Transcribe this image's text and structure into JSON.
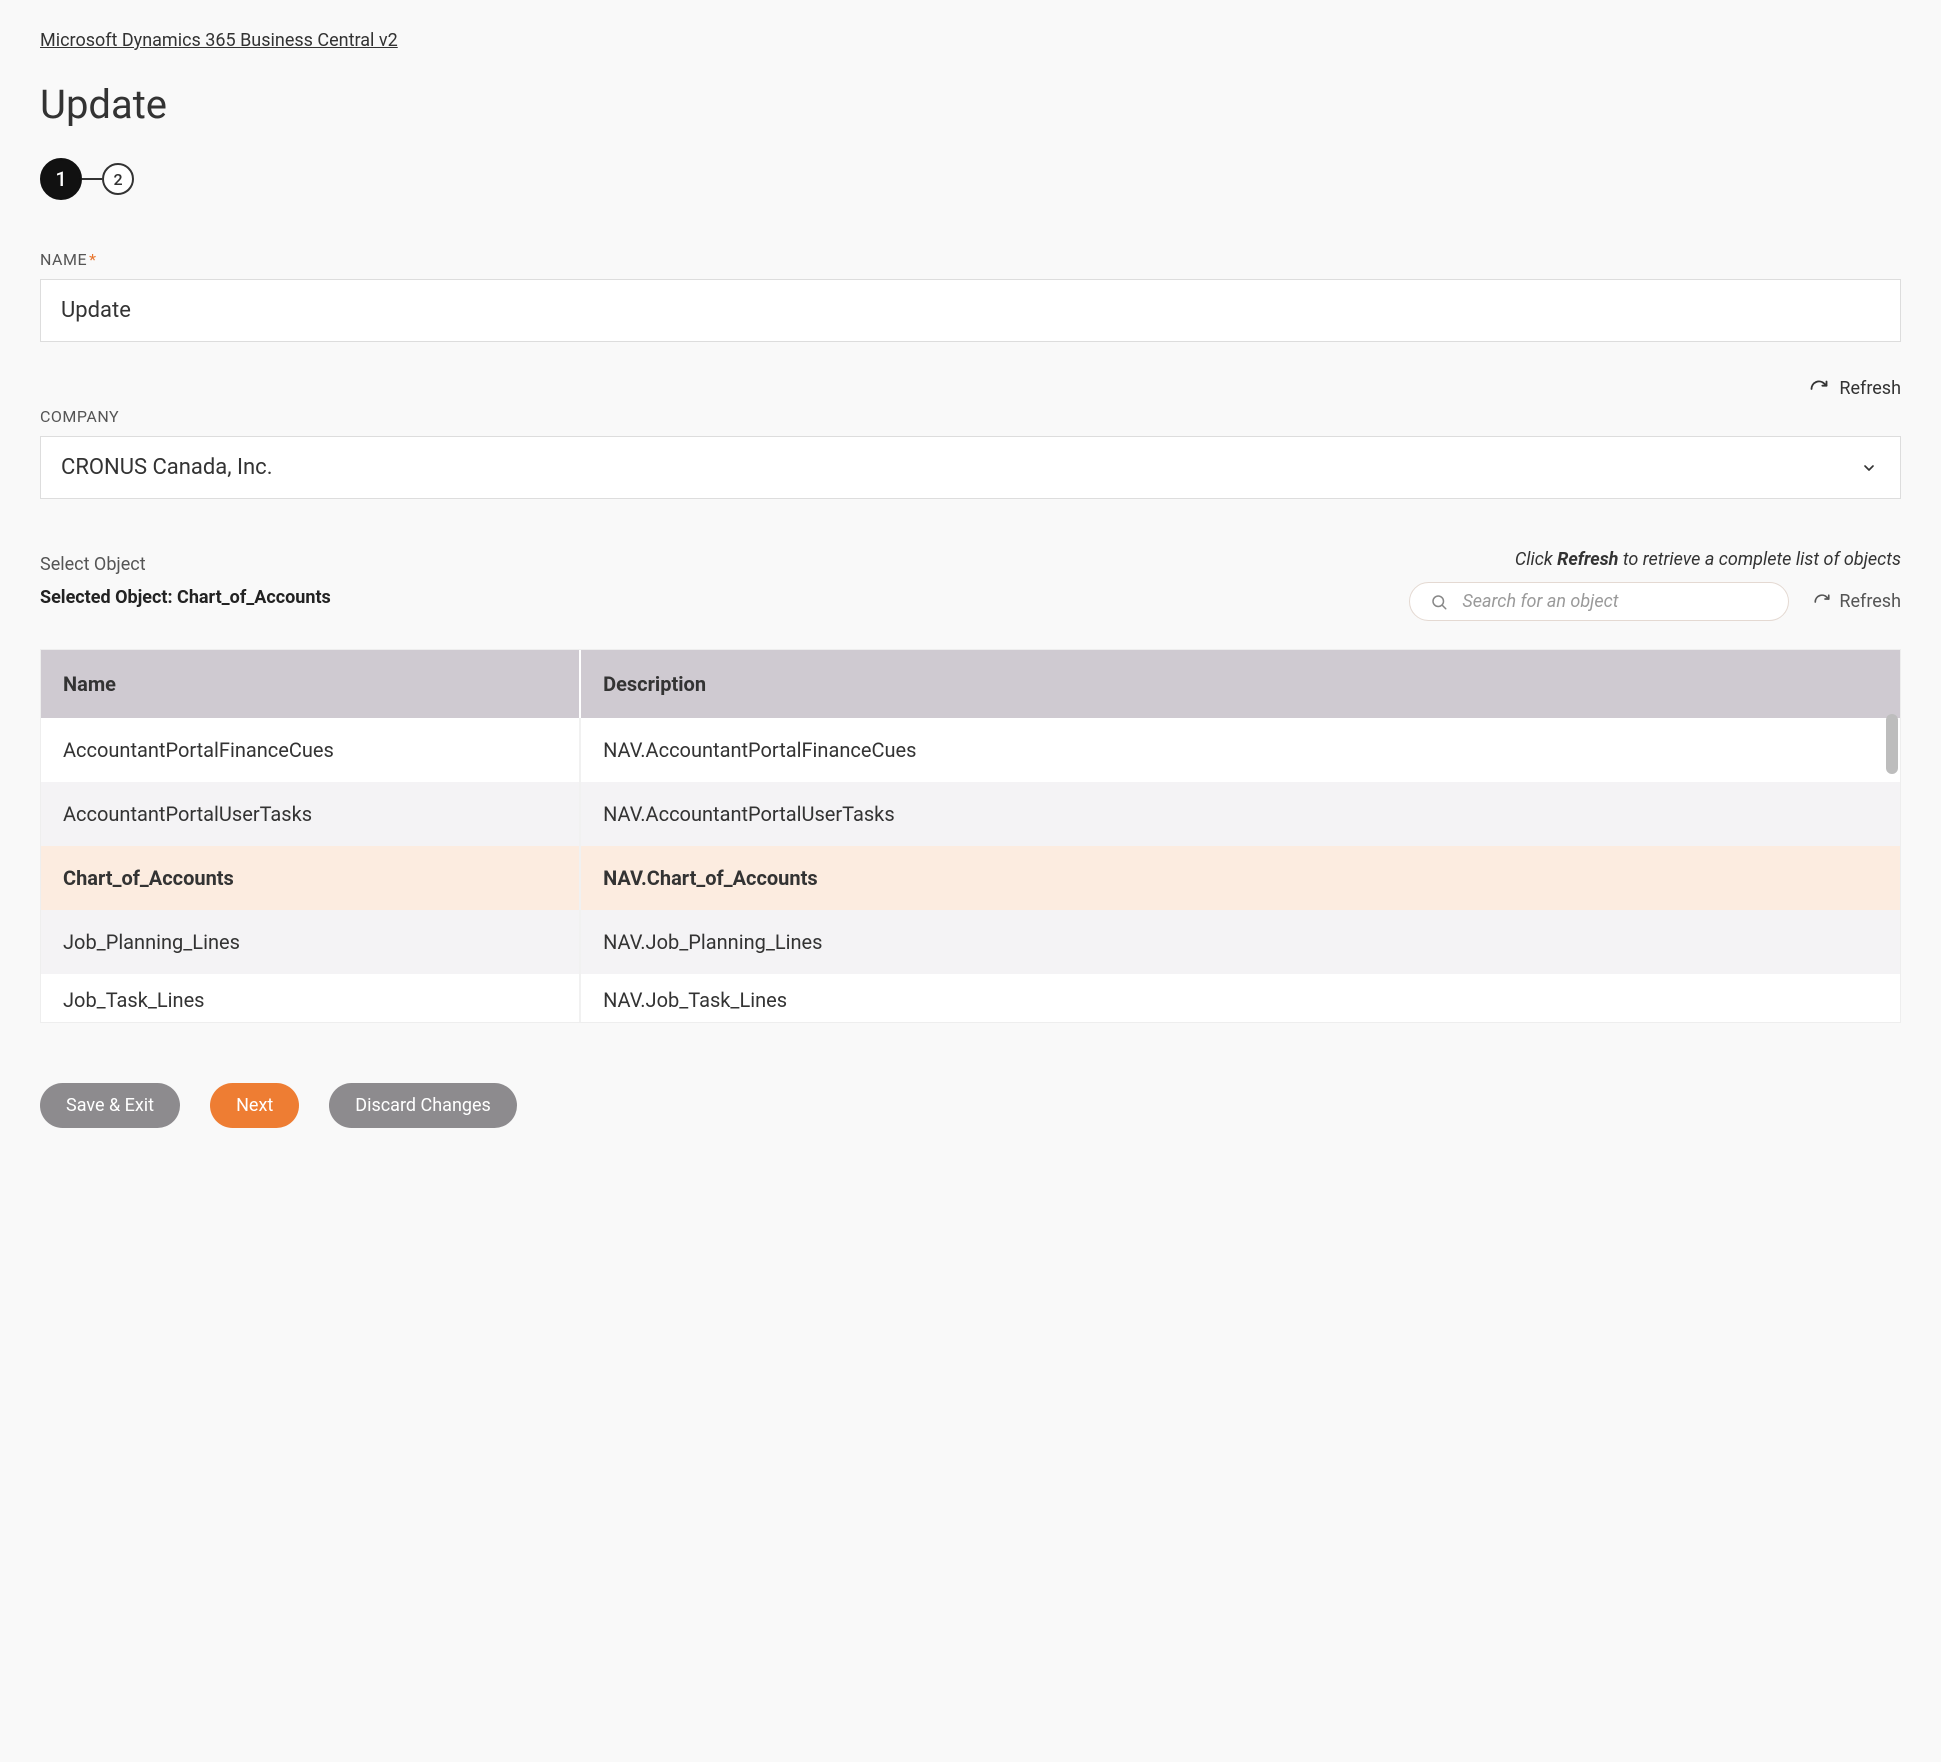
{
  "breadcrumb": {
    "label": "Microsoft Dynamics 365 Business Central v2"
  },
  "page_title": "Update",
  "steps": {
    "s1": "1",
    "s2": "2"
  },
  "name_field": {
    "label": "NAME",
    "required": "*",
    "value": "Update"
  },
  "refresh1": {
    "label": "Refresh"
  },
  "company_field": {
    "label": "COMPANY",
    "value": "CRONUS Canada, Inc."
  },
  "helper": {
    "prefix": "Click ",
    "bold": "Refresh",
    "suffix": " to retrieve a complete list of objects"
  },
  "select_object_label": "Select Object",
  "selected_object": {
    "prefix": "Selected Object: ",
    "name": "Chart_of_Accounts"
  },
  "search": {
    "placeholder": "Search for an object"
  },
  "refresh2": {
    "label": "Refresh"
  },
  "table": {
    "headers": {
      "name": "Name",
      "description": "Description"
    },
    "rows": [
      {
        "name": "AccountantPortalFinanceCues",
        "desc": "NAV.AccountantPortalFinanceCues",
        "selected": false
      },
      {
        "name": "AccountantPortalUserTasks",
        "desc": "NAV.AccountantPortalUserTasks",
        "selected": false
      },
      {
        "name": "Chart_of_Accounts",
        "desc": "NAV.Chart_of_Accounts",
        "selected": true
      },
      {
        "name": "Job_Planning_Lines",
        "desc": "NAV.Job_Planning_Lines",
        "selected": false
      },
      {
        "name": "Job_Task_Lines",
        "desc": "NAV.Job_Task_Lines",
        "selected": false
      }
    ]
  },
  "buttons": {
    "save_exit": "Save & Exit",
    "next": "Next",
    "discard": "Discard Changes"
  }
}
